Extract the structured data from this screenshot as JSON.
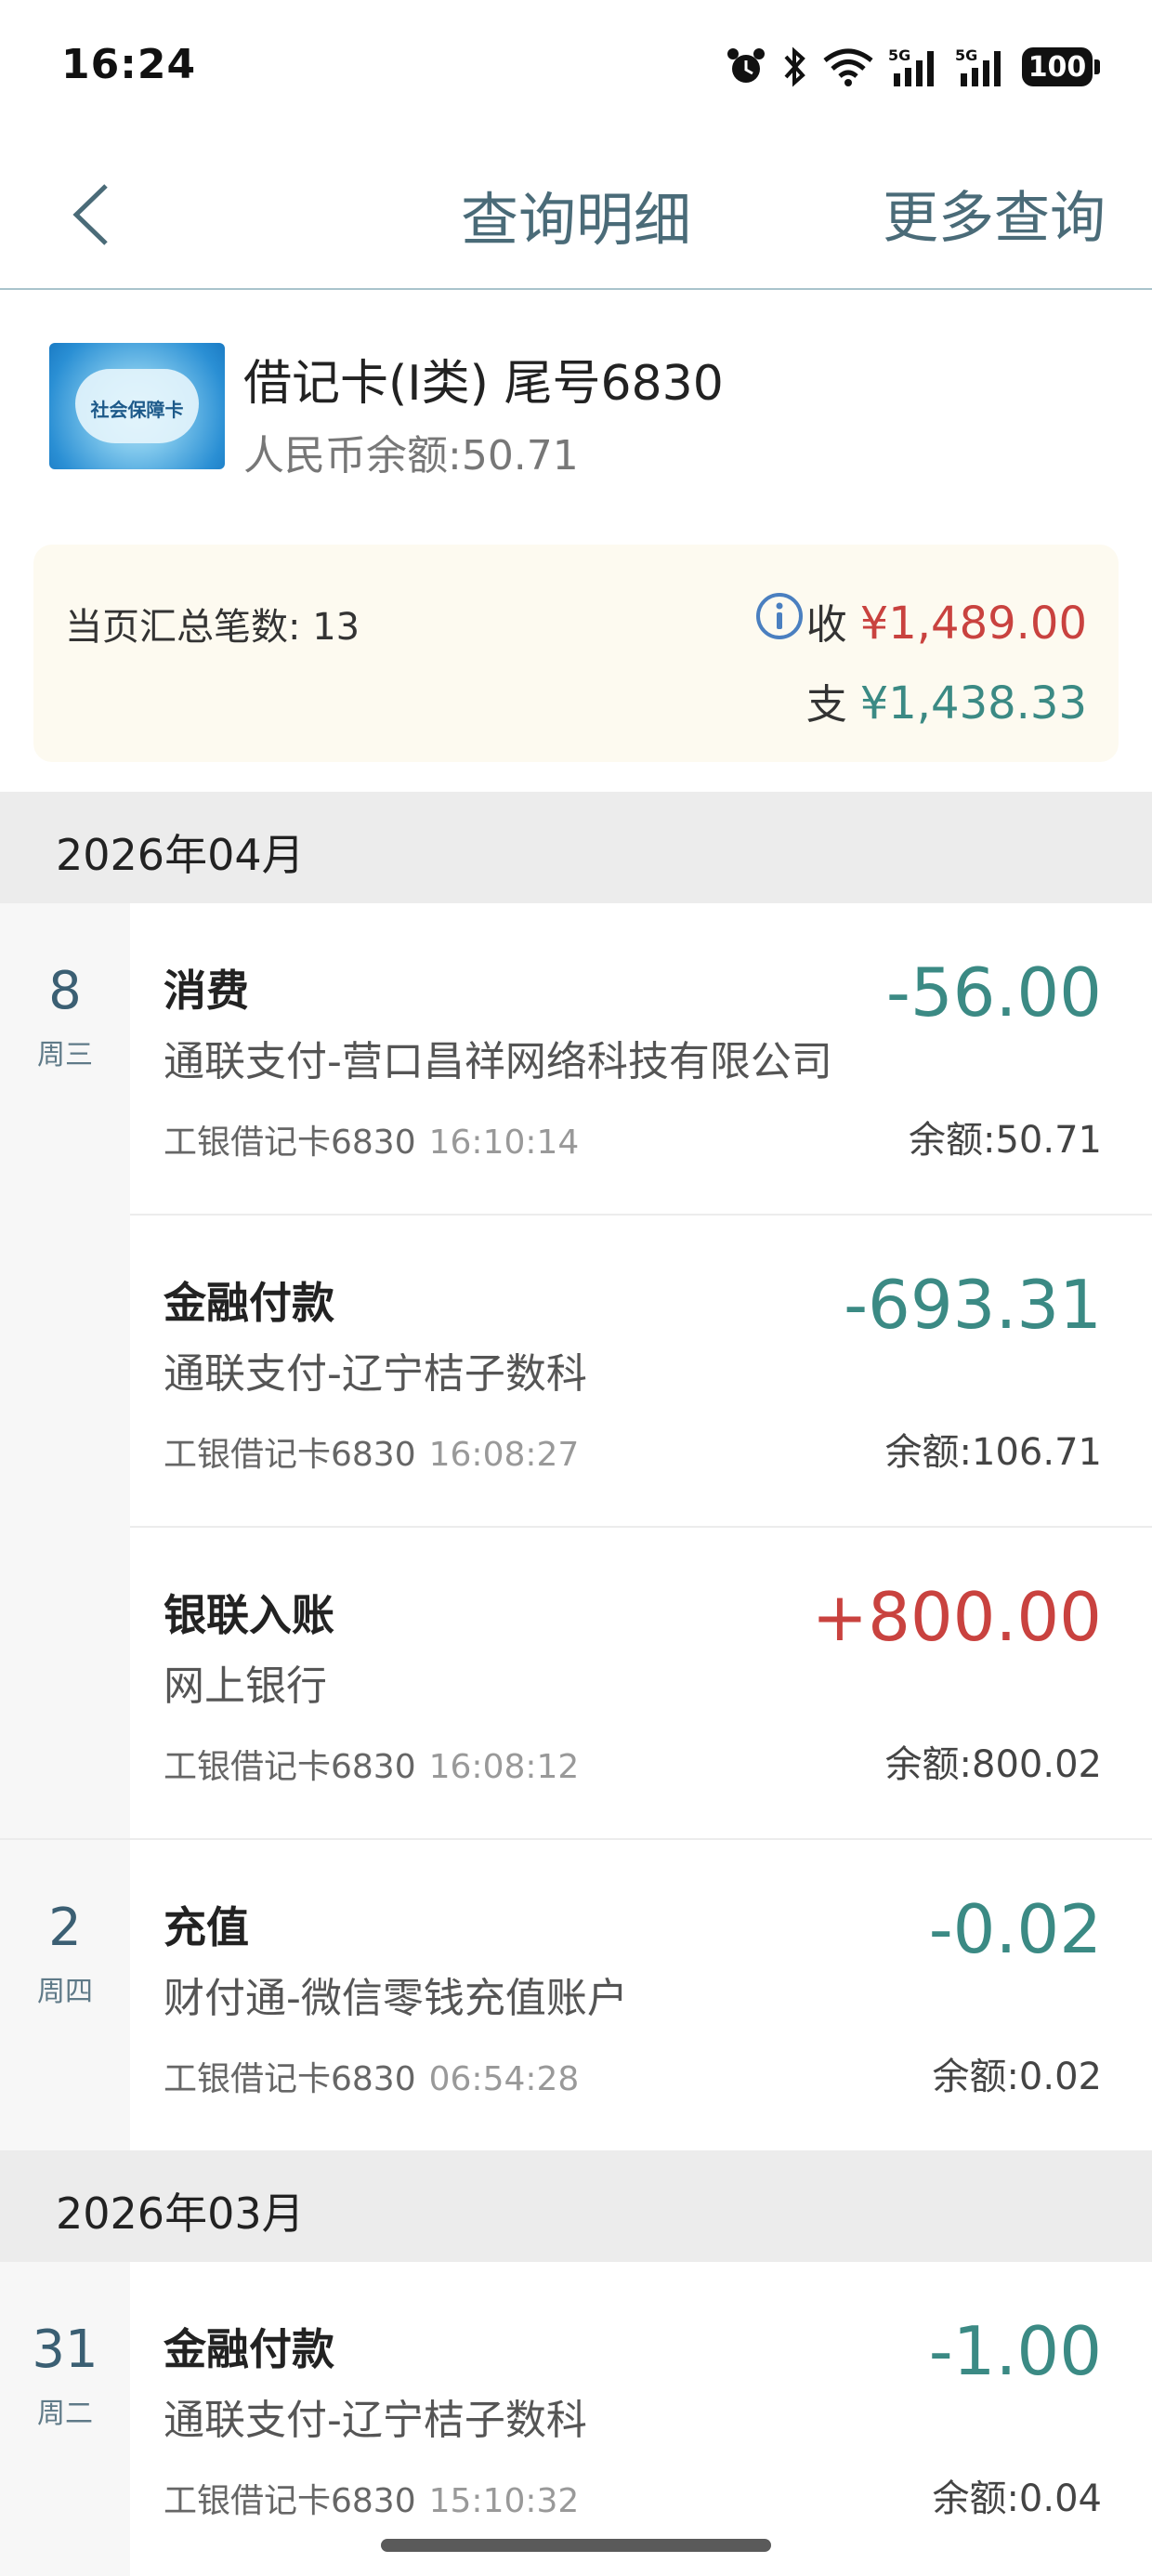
{
  "status_bar": {
    "time": "16:24",
    "battery": "100",
    "net1": "5G",
    "net2": "5G"
  },
  "nav": {
    "title": "查询明细",
    "more": "更多查询"
  },
  "account": {
    "card_name": "借记卡(I类) 尾号6830",
    "balance": "人民币余额:50.71",
    "card_image_text": "社会保障卡"
  },
  "summary": {
    "count": "当页汇总笔数: 13",
    "income_label": "收",
    "income_amount": "¥1,489.00",
    "expense_label": "支",
    "expense_amount": "¥1,438.33"
  },
  "months": [
    {
      "label": "2026年04月"
    },
    {
      "label": "2026年03月"
    }
  ],
  "days": [
    {
      "num": "8",
      "week": "周三"
    },
    {
      "num": "2",
      "week": "周四"
    },
    {
      "num": "31",
      "week": "周二"
    }
  ],
  "transactions": [
    {
      "type": "消费",
      "merchant": "通联支付-营口昌祥网络科技有限公司",
      "card": "工银借记卡6830",
      "time": "16:10:14",
      "amount": "-56.00",
      "balance": "余额:50.71",
      "direction": "out"
    },
    {
      "type": "金融付款",
      "merchant": "通联支付-辽宁桔子数科",
      "card": "工银借记卡6830",
      "time": "16:08:27",
      "amount": "-693.31",
      "balance": "余额:106.71",
      "direction": "out"
    },
    {
      "type": "银联入账",
      "merchant": "网上银行",
      "card": "工银借记卡6830",
      "time": "16:08:12",
      "amount": "+800.00",
      "balance": "余额:800.02",
      "direction": "in"
    },
    {
      "type": "充值",
      "merchant": "财付通-微信零钱充值账户",
      "card": "工银借记卡6830",
      "time": "06:54:28",
      "amount": "-0.02",
      "balance": "余额:0.02",
      "direction": "out"
    },
    {
      "type": "金融付款",
      "merchant": "通联支付-辽宁桔子数科",
      "card": "工银借记卡6830",
      "time": "15:10:32",
      "amount": "-1.00",
      "balance": "余额:0.04",
      "direction": "out"
    }
  ],
  "colors": {
    "income": "#c9423f",
    "expense": "#3b8a84",
    "nav_text": "#4a6b78"
  }
}
